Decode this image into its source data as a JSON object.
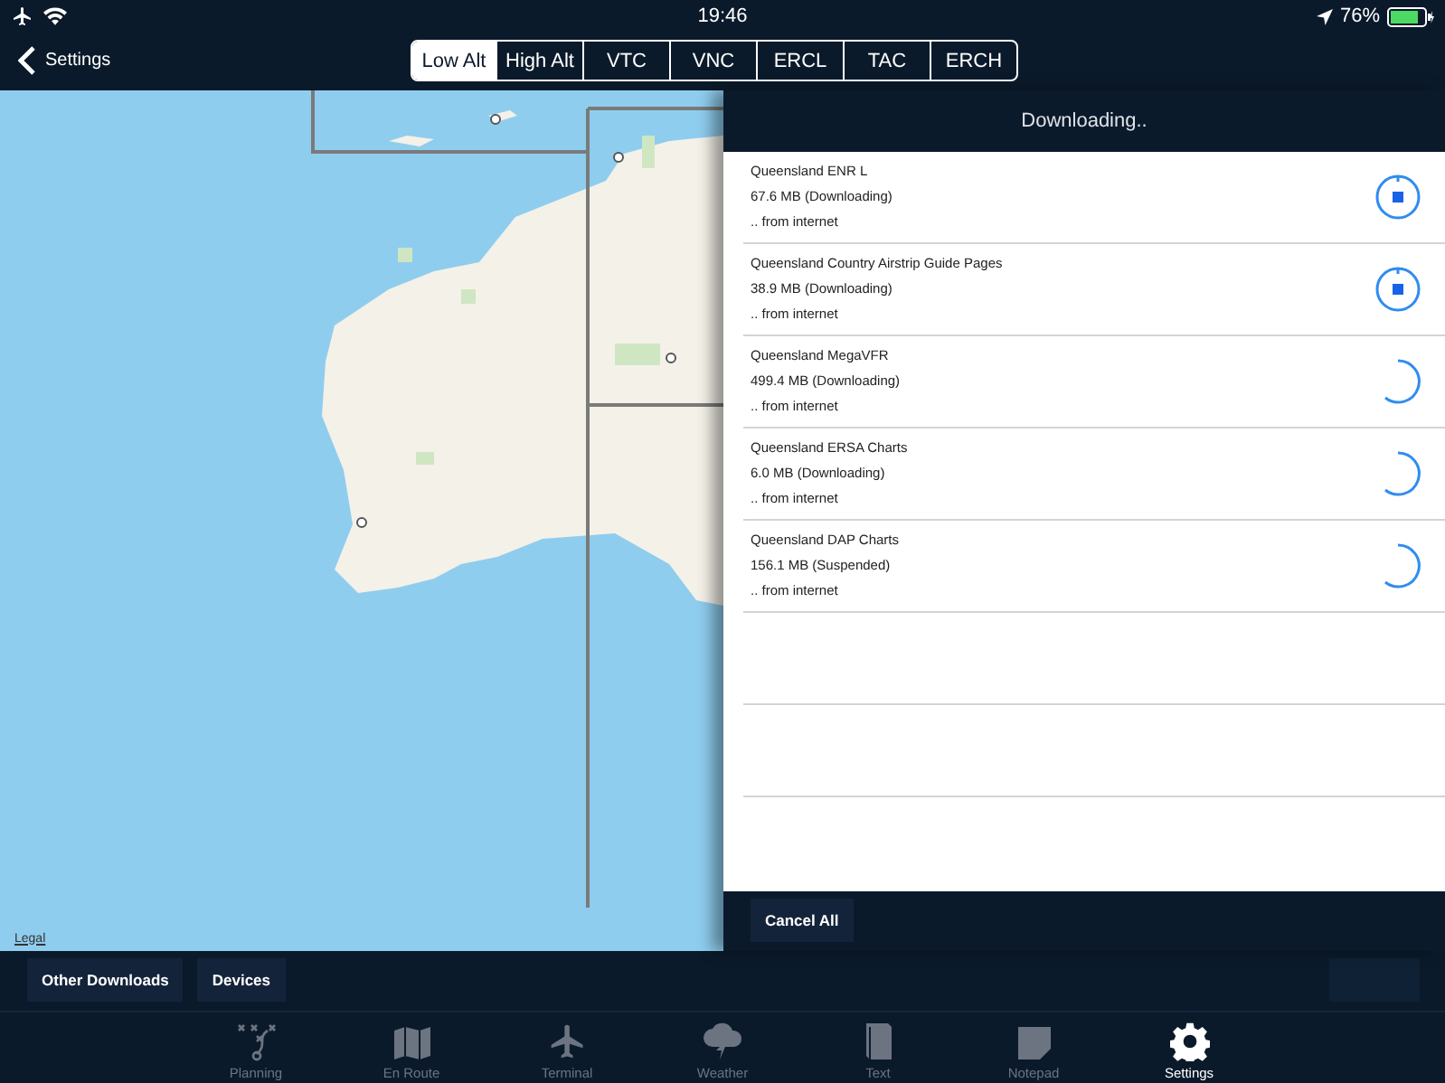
{
  "status_bar": {
    "time": "19:46",
    "battery": "76%"
  },
  "nav": {
    "back": "Settings",
    "segments": [
      {
        "label": "Low Alt",
        "selected": true
      },
      {
        "label": "High Alt",
        "selected": false
      },
      {
        "label": "VTC",
        "selected": false
      },
      {
        "label": "VNC",
        "selected": false
      },
      {
        "label": "ERCL",
        "selected": false
      },
      {
        "label": "TAC",
        "selected": false
      },
      {
        "label": "ERCH",
        "selected": false
      }
    ]
  },
  "map": {
    "legal": "Legal"
  },
  "downloads": {
    "title": "Downloading..",
    "items": [
      {
        "name": "Queensland ENR L",
        "size": "67.6 MB (Downloading)",
        "source": ".. from internet",
        "kind": "stop"
      },
      {
        "name": "Queensland Country Airstrip Guide Pages",
        "size": "38.9 MB (Downloading)",
        "source": ".. from internet",
        "kind": "stop"
      },
      {
        "name": "Queensland MegaVFR",
        "size": "499.4 MB (Downloading)",
        "source": ".. from internet",
        "kind": "spinner"
      },
      {
        "name": "Queensland ERSA Charts",
        "size": "6.0 MB (Downloading)",
        "source": ".. from internet",
        "kind": "spinner"
      },
      {
        "name": "Queensland DAP Charts",
        "size": "156.1 MB (Suspended)",
        "source": ".. from internet",
        "kind": "spinner"
      }
    ],
    "cancel": "Cancel All"
  },
  "toolbar": {
    "buttons": [
      "Other Downloads",
      "Devices"
    ]
  },
  "tab_bar": [
    {
      "label": "Planning",
      "kind": "planning",
      "selected": false
    },
    {
      "label": "En Route",
      "kind": "enroute",
      "selected": false
    },
    {
      "label": "Terminal",
      "kind": "terminal",
      "selected": false
    },
    {
      "label": "Weather",
      "kind": "weather",
      "selected": false
    },
    {
      "label": "Text",
      "kind": "text",
      "selected": false
    },
    {
      "label": "Notepad",
      "kind": "notepad",
      "selected": false
    },
    {
      "label": "Settings",
      "kind": "settings",
      "selected": true
    }
  ]
}
